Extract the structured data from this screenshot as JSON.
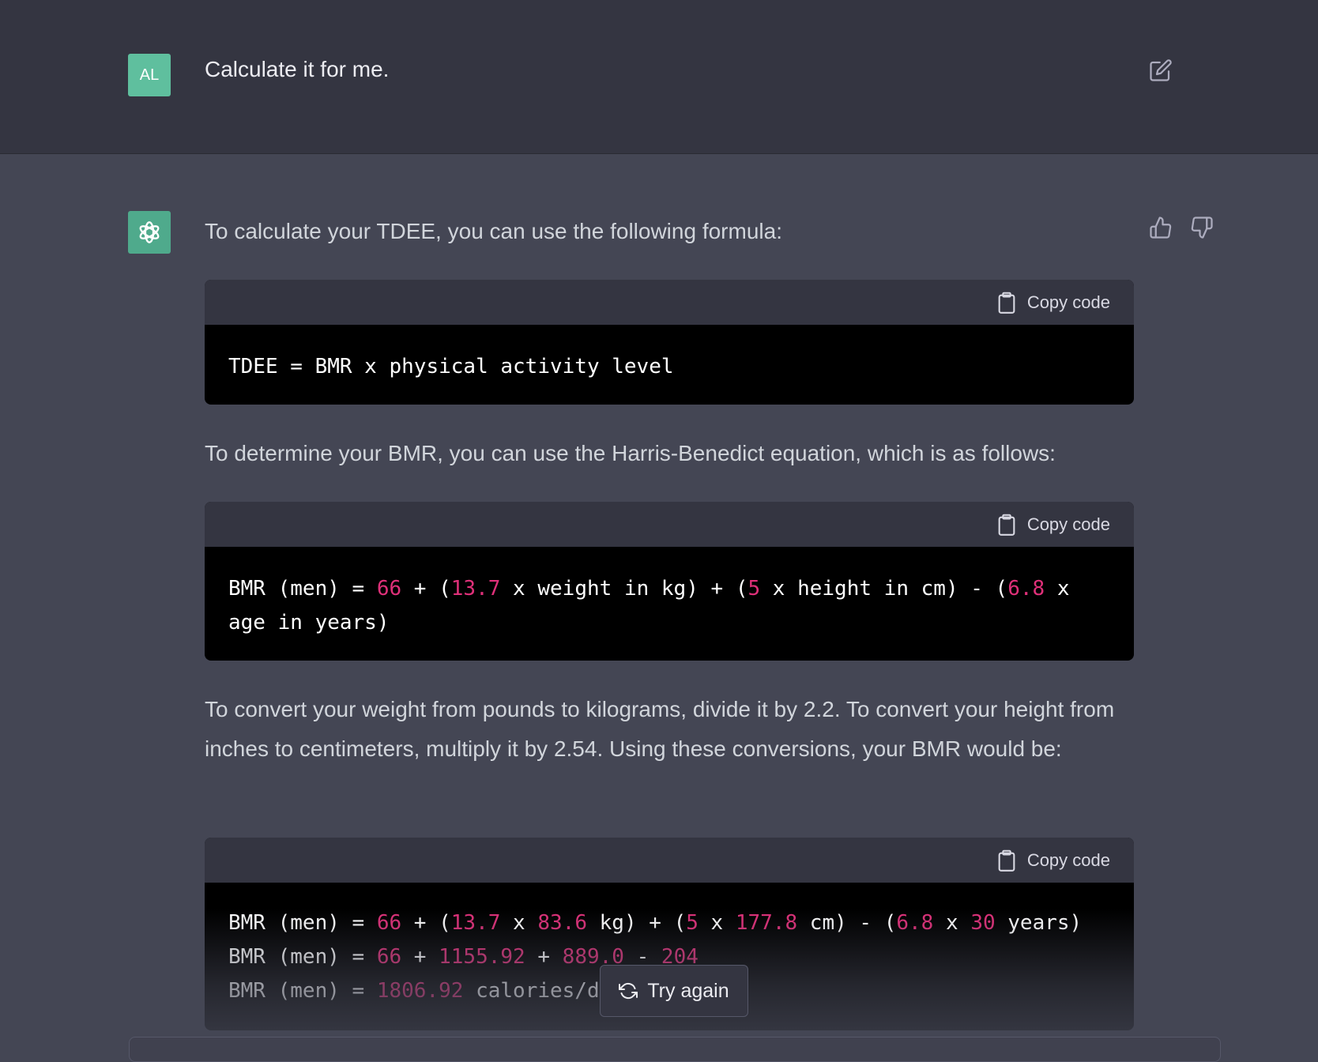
{
  "user_message": {
    "avatar_initials": "AL",
    "text": "Calculate it for me."
  },
  "assistant_message": {
    "para1": "To calculate your TDEE, you can use the following formula:",
    "para2": "To determine your BMR, you can use the Harris-Benedict equation, which is as follows:",
    "para3": "To convert your weight from pounds to kilograms, divide it by 2.2. To convert your height from inches to centimeters, multiply it by 2.54. Using these conversions, your BMR would be:",
    "copy_label": "Copy code",
    "code1": {
      "line1": "TDEE = BMR x physical activity level"
    },
    "code2": {
      "t1": "BMR (men) = ",
      "n1": "66",
      "t2": " + (",
      "n2": "13.7",
      "t3": " x weight in kg) + (",
      "n3": "5",
      "t4": " x height in cm) - (",
      "n4": "6.8",
      "t5": " x age in years)"
    },
    "code3": {
      "l1_t1": "BMR (men) = ",
      "l1_n1": "66",
      "l1_t2": " + (",
      "l1_n2": "13.7",
      "l1_t3": " x ",
      "l1_n3": "83.6",
      "l1_t4": " kg) + (",
      "l1_n4": "5",
      "l1_t5": " x ",
      "l1_n5": "177.8",
      "l1_t6": " cm) - (",
      "l1_n6": "6.8",
      "l1_t7": " x ",
      "l1_n7": "30",
      "l1_t8": " years)",
      "l2_t1": "BMR (men) = ",
      "l2_n1": "66",
      "l2_t2": " + ",
      "l2_n2": "1155.92",
      "l2_t3": " + ",
      "l2_n3": "889.0",
      "l2_t4": " - ",
      "l2_n4": "204",
      "l3_t1": "BMR (men) = ",
      "l3_n1": "1806.92",
      "l3_t2": " calories/day"
    }
  },
  "try_again_label": "Try again",
  "icons": {
    "edit": "edit-icon",
    "thumbs_up": "thumbs-up-icon",
    "thumbs_down": "thumbs-down-icon",
    "clipboard": "clipboard-icon",
    "refresh": "refresh-icon",
    "openai": "openai-logo-icon"
  },
  "colors": {
    "background_user": "#343541",
    "background_assistant": "#444654",
    "code_number": "#df3079",
    "avatar": "#5fbf9e"
  }
}
